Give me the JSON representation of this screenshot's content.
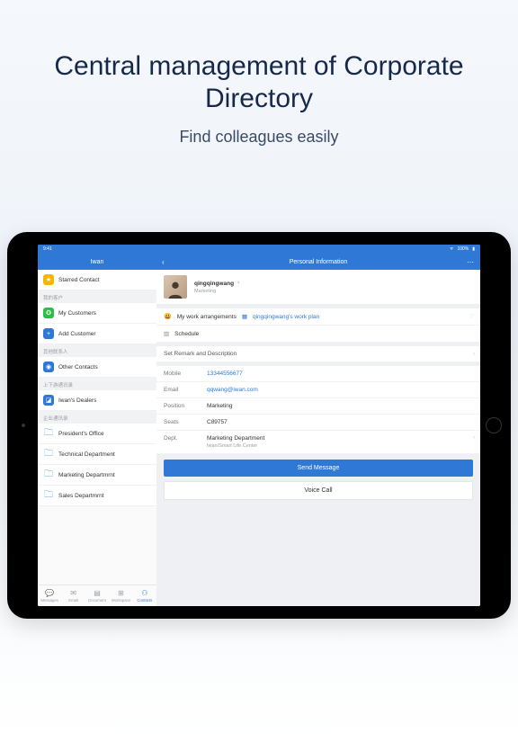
{
  "promo": {
    "title_line1": "Central management of  Corporate",
    "title_line2": "Directory",
    "subtitle": "Find colleagues easily"
  },
  "status": {
    "time": "9:41",
    "battery": "100%"
  },
  "header": {
    "left_title": "Iwan",
    "right_title": "Personal Information"
  },
  "sidebar": {
    "sections": {
      "top": [
        {
          "icon": "star",
          "label": "Starred Contact"
        }
      ],
      "my_customers_label": "我的客户",
      "my_customers": [
        {
          "icon": "wechat",
          "label": "My Customers"
        },
        {
          "icon": "plus",
          "label": "Add Customer"
        }
      ],
      "other_label": "其他联系人",
      "other": [
        {
          "icon": "other",
          "label": "Other Contacts"
        }
      ],
      "updown_label": "上下游通讯录",
      "updown": [
        {
          "icon": "iw",
          "label": "Iwan's Dealers"
        }
      ],
      "corp_label": "企业通讯录",
      "corp": [
        {
          "icon": "folder",
          "label": "President's Office"
        },
        {
          "icon": "folder",
          "label": "Technical Department"
        },
        {
          "icon": "folder",
          "label": "Marketing Departmrnt"
        },
        {
          "icon": "folder",
          "label": "Sales Departmrnt"
        }
      ]
    }
  },
  "profile": {
    "name": "qingqingwang",
    "subtitle": "Marketing",
    "signature_prefix": "My work arrangements",
    "signature_link": "qingqingwang's work plan",
    "schedule_label": "Schedule"
  },
  "details": {
    "remark_row": "Set Remark and Description",
    "mobile": {
      "label": "Mobile",
      "value": "13344556677"
    },
    "email": {
      "label": "Email",
      "value": "qqwang@iwan.com"
    },
    "position": {
      "label": "Position",
      "value": "Marketing"
    },
    "seats": {
      "label": "Seats",
      "value": "C89757"
    },
    "dept": {
      "label": "Dept.",
      "value": "Marketing Department",
      "sub": "Iwan/Smart Life Center"
    }
  },
  "actions": {
    "send": "Send Message",
    "voice": "Voice Call"
  },
  "tabs": [
    {
      "icon": "💬",
      "label": "Messages"
    },
    {
      "icon": "✉",
      "label": "Email"
    },
    {
      "icon": "▤",
      "label": "Document"
    },
    {
      "icon": "⊞",
      "label": "Workspace"
    },
    {
      "icon": "⚇",
      "label": "Contacts",
      "active": true
    }
  ]
}
